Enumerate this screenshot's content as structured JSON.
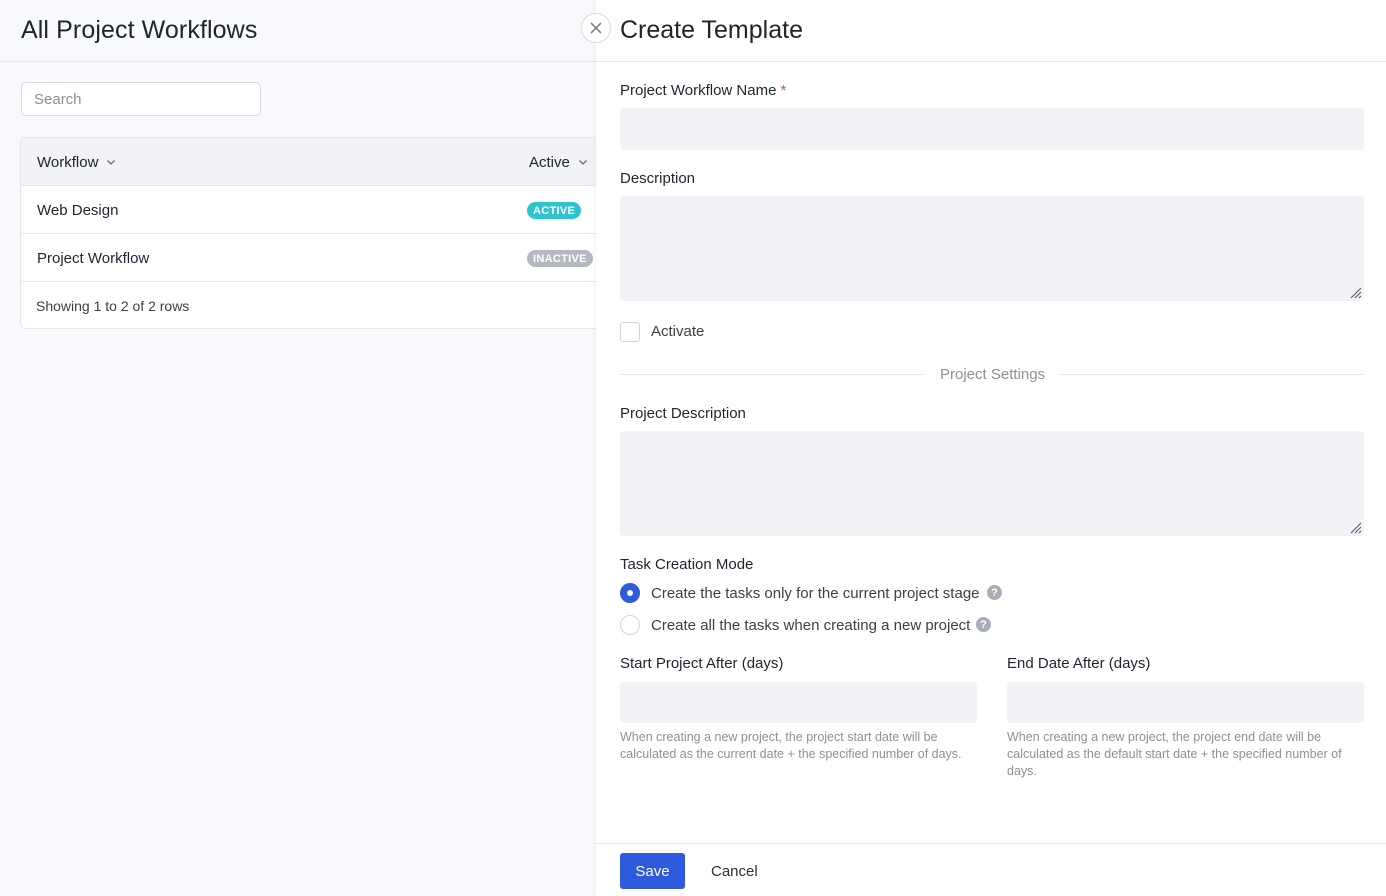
{
  "list_page": {
    "title": "All Project Workflows",
    "search_placeholder": "Search",
    "columns": {
      "workflow": "Workflow",
      "active": "Active"
    },
    "rows": [
      {
        "name": "Web Design",
        "status": "ACTIVE"
      },
      {
        "name": "Project Workflow",
        "status": "INACTIVE"
      }
    ],
    "footer": "Showing 1 to 2 of 2 rows"
  },
  "drawer": {
    "title": "Create Template",
    "name_label": "Project Workflow Name",
    "required_mark": "*",
    "description_label": "Description",
    "activate_label": "Activate",
    "section_divider": "Project Settings",
    "project_description_label": "Project Description",
    "task_mode_label": "Task Creation Mode",
    "task_mode_options": [
      {
        "label": "Create the tasks only for the current project stage",
        "selected": true
      },
      {
        "label": "Create all the tasks when creating a new project",
        "selected": false
      }
    ],
    "help_glyph": "?",
    "start_after_label": "Start Project After (days)",
    "start_after_hint": "When creating a new project, the project start date will be calculated as the current date + the specified number of days.",
    "end_after_label": "End Date After (days)",
    "end_after_hint": "When creating a new project, the project end date will be calculated as the default start date + the specified number of days.",
    "save_label": "Save",
    "cancel_label": "Cancel"
  },
  "colors": {
    "primary": "#2e5bde",
    "active_badge": "#2ec4cf",
    "inactive_badge": "#b5b8c0",
    "required": "#e5484d"
  }
}
